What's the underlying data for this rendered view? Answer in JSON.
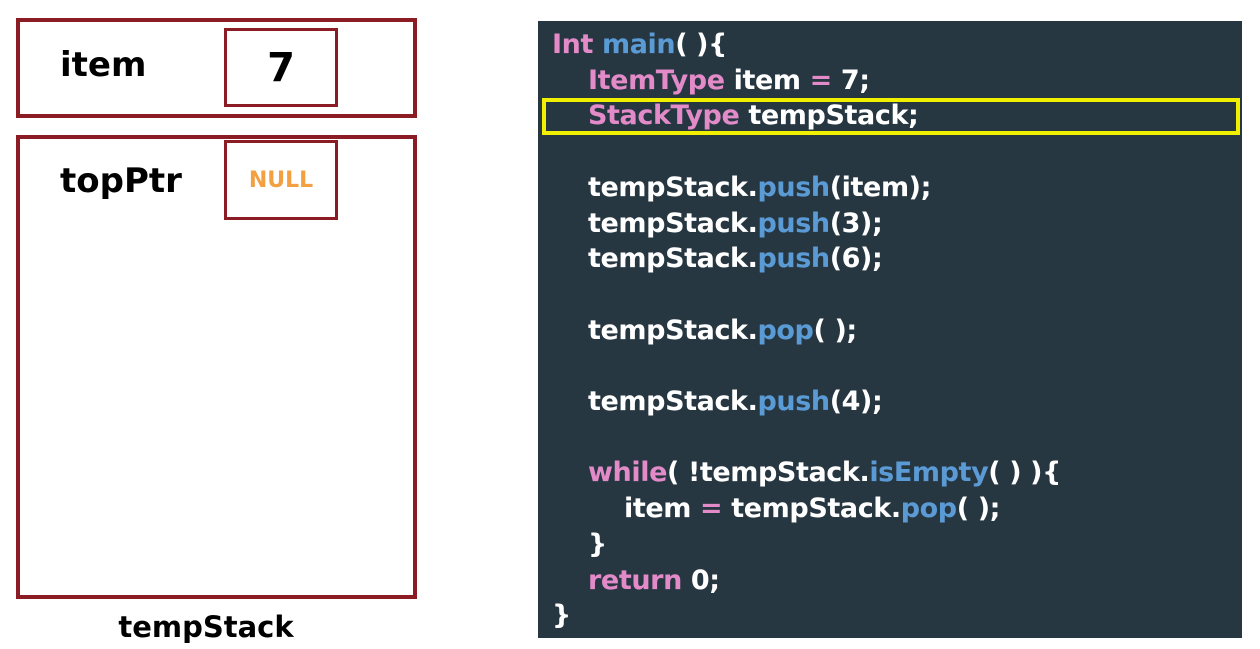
{
  "item_box": {
    "label": "item",
    "value": "7"
  },
  "stack_box": {
    "label": "topPtr",
    "value": "NULL",
    "value_color": "#f2a041",
    "caption": "tempStack"
  },
  "colors": {
    "border": "#8b1c24",
    "code_bg": "#273742",
    "keyword": "#e38ac9",
    "method": "#5b9bd5",
    "highlight": "#f0f000"
  },
  "code": {
    "highlighted_line": 2,
    "lines": [
      [
        {
          "t": "Int ",
          "c": "kw"
        },
        {
          "t": "main",
          "c": "fn"
        },
        {
          "t": "( ){",
          "c": "w"
        }
      ],
      [
        {
          "t": "    ",
          "c": "w"
        },
        {
          "t": "ItemType",
          "c": "kw"
        },
        {
          "t": " item ",
          "c": "w"
        },
        {
          "t": "=",
          "c": "kw"
        },
        {
          "t": " 7;",
          "c": "w"
        }
      ],
      [
        {
          "t": "    ",
          "c": "w"
        },
        {
          "t": "StackType",
          "c": "kw"
        },
        {
          "t": " tempStack;",
          "c": "w"
        }
      ],
      [],
      [
        {
          "t": "    tempStack.",
          "c": "w"
        },
        {
          "t": "push",
          "c": "fn"
        },
        {
          "t": "(item);",
          "c": "w"
        }
      ],
      [
        {
          "t": "    tempStack.",
          "c": "w"
        },
        {
          "t": "push",
          "c": "fn"
        },
        {
          "t": "(3);",
          "c": "w"
        }
      ],
      [
        {
          "t": "    tempStack.",
          "c": "w"
        },
        {
          "t": "push",
          "c": "fn"
        },
        {
          "t": "(6);",
          "c": "w"
        }
      ],
      [],
      [
        {
          "t": "    tempStack.",
          "c": "w"
        },
        {
          "t": "pop",
          "c": "fn"
        },
        {
          "t": "( );",
          "c": "w"
        }
      ],
      [],
      [
        {
          "t": "    tempStack.",
          "c": "w"
        },
        {
          "t": "push",
          "c": "fn"
        },
        {
          "t": "(4);",
          "c": "w"
        }
      ],
      [],
      [
        {
          "t": "    ",
          "c": "w"
        },
        {
          "t": "while",
          "c": "kw"
        },
        {
          "t": "( !tempStack.",
          "c": "w"
        },
        {
          "t": "isEmpty",
          "c": "fn"
        },
        {
          "t": "( ) ){",
          "c": "w"
        }
      ],
      [
        {
          "t": "        item ",
          "c": "w"
        },
        {
          "t": "=",
          "c": "kw"
        },
        {
          "t": " tempStack.",
          "c": "w"
        },
        {
          "t": "pop",
          "c": "fn"
        },
        {
          "t": "( );",
          "c": "w"
        }
      ],
      [
        {
          "t": "    }",
          "c": "w"
        }
      ],
      [
        {
          "t": "    ",
          "c": "w"
        },
        {
          "t": "return",
          "c": "kw"
        },
        {
          "t": " 0;",
          "c": "w"
        }
      ],
      [
        {
          "t": "}",
          "c": "w"
        }
      ]
    ]
  }
}
